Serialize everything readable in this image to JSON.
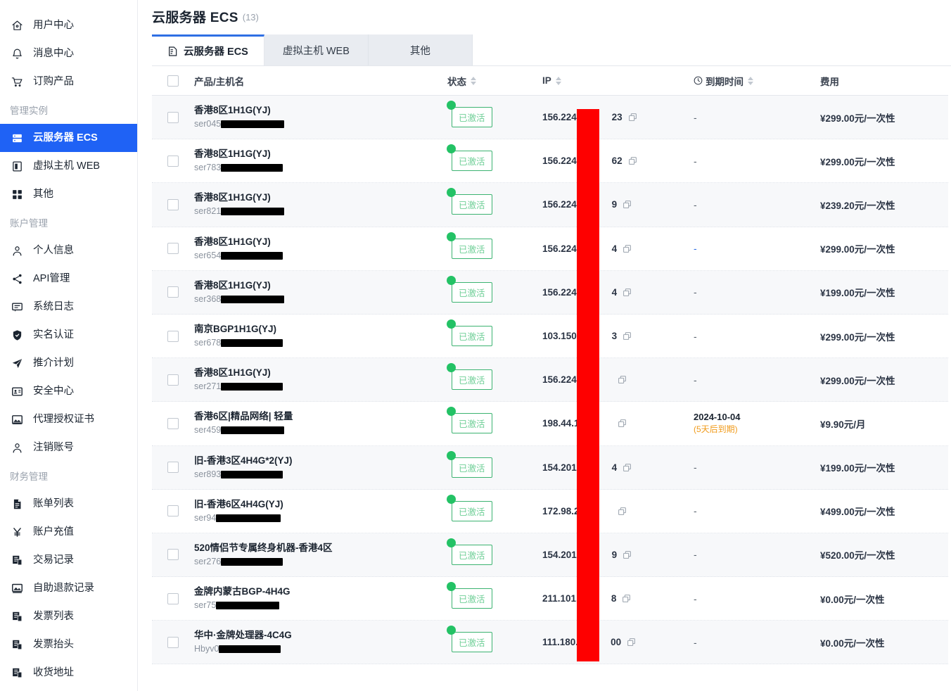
{
  "sidebar": {
    "items": [
      {
        "label": "用户中心",
        "icon": "home-icon",
        "type": "item",
        "active": false
      },
      {
        "label": "消息中心",
        "icon": "bell-icon",
        "type": "item",
        "active": false
      },
      {
        "label": "订购产品",
        "icon": "cart-icon",
        "type": "item",
        "active": false
      },
      {
        "label": "管理实例",
        "icon": "",
        "type": "group",
        "active": false
      },
      {
        "label": "云服务器 ECS",
        "icon": "server-icon",
        "type": "item",
        "active": true
      },
      {
        "label": "虚拟主机 WEB",
        "icon": "web-icon",
        "type": "item",
        "active": false
      },
      {
        "label": "其他",
        "icon": "grid-icon",
        "type": "item",
        "active": false
      },
      {
        "label": "账户管理",
        "icon": "",
        "type": "group",
        "active": false
      },
      {
        "label": "个人信息",
        "icon": "user-icon",
        "type": "item",
        "active": false
      },
      {
        "label": "API管理",
        "icon": "share-icon",
        "type": "item",
        "active": false
      },
      {
        "label": "系统日志",
        "icon": "comment-icon",
        "type": "item",
        "active": false
      },
      {
        "label": "实名认证",
        "icon": "shield-icon",
        "type": "item",
        "active": false
      },
      {
        "label": "推介计划",
        "icon": "send-icon",
        "type": "item",
        "active": false
      },
      {
        "label": "安全中心",
        "icon": "idcard-icon",
        "type": "item",
        "active": false
      },
      {
        "label": "代理授权证书",
        "icon": "certificate-icon",
        "type": "item",
        "active": false
      },
      {
        "label": "注销账号",
        "icon": "user-icon",
        "type": "item",
        "active": false
      },
      {
        "label": "财务管理",
        "icon": "",
        "type": "group",
        "active": false
      },
      {
        "label": "账单列表",
        "icon": "doc-icon",
        "type": "item",
        "active": false
      },
      {
        "label": "账户充值",
        "icon": "yen-icon",
        "type": "item",
        "active": false
      },
      {
        "label": "交易记录",
        "icon": "records-icon",
        "type": "item",
        "active": false
      },
      {
        "label": "自助退款记录",
        "icon": "refund-icon",
        "type": "item",
        "active": false
      },
      {
        "label": "发票列表",
        "icon": "records-icon",
        "type": "item",
        "active": false
      },
      {
        "label": "发票抬头",
        "icon": "records-icon",
        "type": "item",
        "active": false
      },
      {
        "label": "收货地址",
        "icon": "records-icon",
        "type": "item",
        "active": false
      }
    ]
  },
  "header": {
    "title": "云服务器 ECS",
    "count": "(13)"
  },
  "tabs": [
    {
      "label": "云服务器 ECS",
      "icon": "server-doc-icon",
      "active": true
    },
    {
      "label": "虚拟主机 WEB",
      "icon": "",
      "active": false
    },
    {
      "label": "其他",
      "icon": "",
      "active": false
    }
  ],
  "table": {
    "columns": {
      "name": "产品/主机名",
      "state": "状态",
      "ip": "IP",
      "expire": "到期时间",
      "fee": "费用"
    },
    "rows": [
      {
        "product": "香港8区1H1G(YJ)",
        "host": "ser045",
        "host_redact": 90,
        "state": "已激活",
        "ip": "156.224.",
        "ip_tail": "23",
        "expire": "-",
        "expire_note": "",
        "fee": "¥299.00元/一次性",
        "expire_is_link": false
      },
      {
        "product": "香港8区1H1G(YJ)",
        "host": "ser783",
        "host_redact": 88,
        "state": "已激活",
        "ip": "156.224.",
        "ip_tail": "62",
        "expire": "-",
        "expire_note": "",
        "fee": "¥299.00元/一次性",
        "expire_is_link": false
      },
      {
        "product": "香港8区1H1G(YJ)",
        "host": "ser821",
        "host_redact": 90,
        "state": "已激活",
        "ip": "156.224.",
        "ip_tail": "9",
        "expire": "-",
        "expire_note": "",
        "fee": "¥239.20元/一次性",
        "expire_is_link": false
      },
      {
        "product": "香港8区1H1G(YJ)",
        "host": "ser654",
        "host_redact": 88,
        "state": "已激活",
        "ip": "156.224.",
        "ip_tail": "4",
        "expire": "-",
        "expire_note": "",
        "fee": "¥299.00元/一次性",
        "expire_is_link": true
      },
      {
        "product": "香港8区1H1G(YJ)",
        "host": "ser368",
        "host_redact": 90,
        "state": "已激活",
        "ip": "156.224.",
        "ip_tail": "4",
        "expire": "-",
        "expire_note": "",
        "fee": "¥199.00元/一次性",
        "expire_is_link": false
      },
      {
        "product": "南京BGP1H1G(YJ)",
        "host": "ser678",
        "host_redact": 88,
        "state": "已激活",
        "ip": "103.150.",
        "ip_tail": "3",
        "expire": "-",
        "expire_note": "",
        "fee": "¥299.00元/一次性",
        "expire_is_link": false
      },
      {
        "product": "香港8区1H1G(YJ)",
        "host": "ser271",
        "host_redact": 88,
        "state": "已激活",
        "ip": "156.224.",
        "ip_tail": "",
        "expire": "-",
        "expire_note": "",
        "fee": "¥299.00元/一次性",
        "expire_is_link": false
      },
      {
        "product": "香港6区|精品网络| 轻量",
        "host": "ser459",
        "host_redact": 90,
        "state": "已激活",
        "ip": "198.44.1",
        "ip_tail": "",
        "expire": "2024-10-04",
        "expire_note": "(5天后到期)",
        "fee": "¥9.90元/月",
        "expire_is_link": false
      },
      {
        "product": "旧-香港3区4H4G*2(YJ)",
        "host": "ser893",
        "host_redact": 88,
        "state": "已激活",
        "ip": "154.201.",
        "ip_tail": "4",
        "expire": "-",
        "expire_note": "",
        "fee": "¥199.00元/一次性",
        "expire_is_link": false
      },
      {
        "product": "旧-香港6区4H4G(YJ)",
        "host": "ser94",
        "host_redact": 92,
        "state": "已激活",
        "ip": "172.98.2",
        "ip_tail": "",
        "expire": "-",
        "expire_note": "",
        "fee": "¥499.00元/一次性",
        "expire_is_link": false
      },
      {
        "product": "520情侣节专属终身机器-香港4区",
        "host": "ser276",
        "host_redact": 88,
        "state": "已激活",
        "ip": "154.201.",
        "ip_tail": "9",
        "expire": "-",
        "expire_note": "",
        "fee": "¥520.00元/一次性",
        "expire_is_link": false
      },
      {
        "product": "金牌内蒙古BGP-4H4G",
        "host": "ser75",
        "host_redact": 90,
        "state": "已激活",
        "ip": "211.101.",
        "ip_tail": "8",
        "expire": "-",
        "expire_note": "",
        "fee": "¥0.00元/一次性",
        "expire_is_link": false
      },
      {
        "product": "华中·金牌处理器-4C4G",
        "host": "Hbyv0",
        "host_redact": 88,
        "state": "已激活",
        "ip": "111.180.",
        "ip_tail": "00",
        "expire": "-",
        "expire_note": "",
        "fee": "¥0.00元/一次性",
        "expire_is_link": false
      }
    ]
  },
  "colors": {
    "accent": "#1f62f5",
    "tab_accent": "#2f6fe4",
    "status_green": "#23c265",
    "status_border": "#3cb371",
    "warn_orange": "#f09a1a",
    "redaction_red": "#fe0000",
    "row_alt": "#f7f8fa"
  }
}
